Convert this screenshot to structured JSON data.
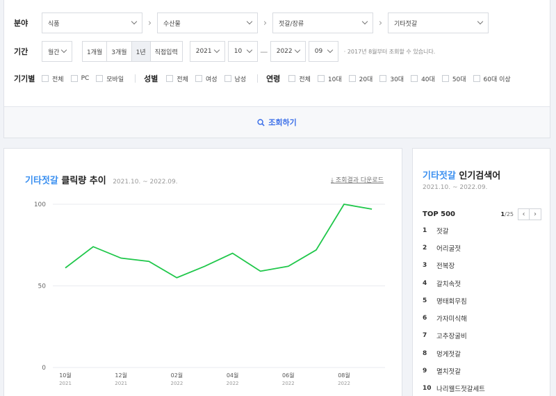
{
  "filters": {
    "category_label": "분야",
    "categories": [
      "식품",
      "수산물",
      "젓갈/장류",
      "기타젓갈"
    ],
    "period_label": "기간",
    "period_unit": "월간",
    "quick_ranges": [
      "1개월",
      "3개월",
      "1년",
      "직접입력"
    ],
    "start_year": "2021",
    "start_month": "10",
    "end_year": "2022",
    "end_month": "09",
    "period_note": "· 2017년 8월부터 조회할 수 있습니다.",
    "device_label": "기기별",
    "devices": [
      "전체",
      "PC",
      "모바일"
    ],
    "gender_label": "성별",
    "genders": [
      "전체",
      "여성",
      "남성"
    ],
    "age_label": "연령",
    "ages": [
      "전체",
      "10대",
      "20대",
      "30대",
      "40대",
      "50대",
      "60대 이상"
    ],
    "search_button": "조회하기"
  },
  "chart": {
    "title_highlight": "기타젓갈",
    "title_rest": "클릭량 추이",
    "range": "2021.10. ~ 2022.09.",
    "download": "조회결과 다운로드"
  },
  "chart_data": {
    "type": "line",
    "x": [
      "2021-10",
      "2021-11",
      "2021-12",
      "2022-01",
      "2022-02",
      "2022-03",
      "2022-04",
      "2022-05",
      "2022-06",
      "2022-07",
      "2022-08",
      "2022-09"
    ],
    "series": [
      {
        "values": [
          61,
          74,
          67,
          65,
          55,
          62,
          70,
          59,
          62,
          72,
          100,
          97
        ]
      }
    ],
    "ylim": [
      0,
      100
    ],
    "yticks": [
      "100",
      "50",
      "0"
    ],
    "xtick_labels": [
      {
        "month": "10월",
        "year": "2021"
      },
      {
        "month": "12월",
        "year": "2021"
      },
      {
        "month": "02월",
        "year": "2022"
      },
      {
        "month": "04월",
        "year": "2022"
      },
      {
        "month": "06월",
        "year": "2022"
      },
      {
        "month": "08월",
        "year": "2022"
      }
    ],
    "line_color": "#1fc74a",
    "grid": true
  },
  "side": {
    "title_highlight": "기타젓갈",
    "title_rest": "인기검색어",
    "range": "2021.10. ~ 2022.09.",
    "top_label": "TOP 500",
    "page_current": "1",
    "page_total": "/25",
    "keywords": [
      {
        "rank": "1",
        "text": "젓갈"
      },
      {
        "rank": "2",
        "text": "어리굴젓"
      },
      {
        "rank": "3",
        "text": "전복장"
      },
      {
        "rank": "4",
        "text": "갈치속젓"
      },
      {
        "rank": "5",
        "text": "명태회무침"
      },
      {
        "rank": "6",
        "text": "가자미식해"
      },
      {
        "rank": "7",
        "text": "고추장굴비"
      },
      {
        "rank": "8",
        "text": "멍게젓갈"
      },
      {
        "rank": "9",
        "text": "멸치젓갈"
      },
      {
        "rank": "10",
        "text": "나리웰드젓갈세트"
      }
    ]
  },
  "colors": {
    "accent": "#3a8ff0",
    "line": "#1fc74a"
  }
}
